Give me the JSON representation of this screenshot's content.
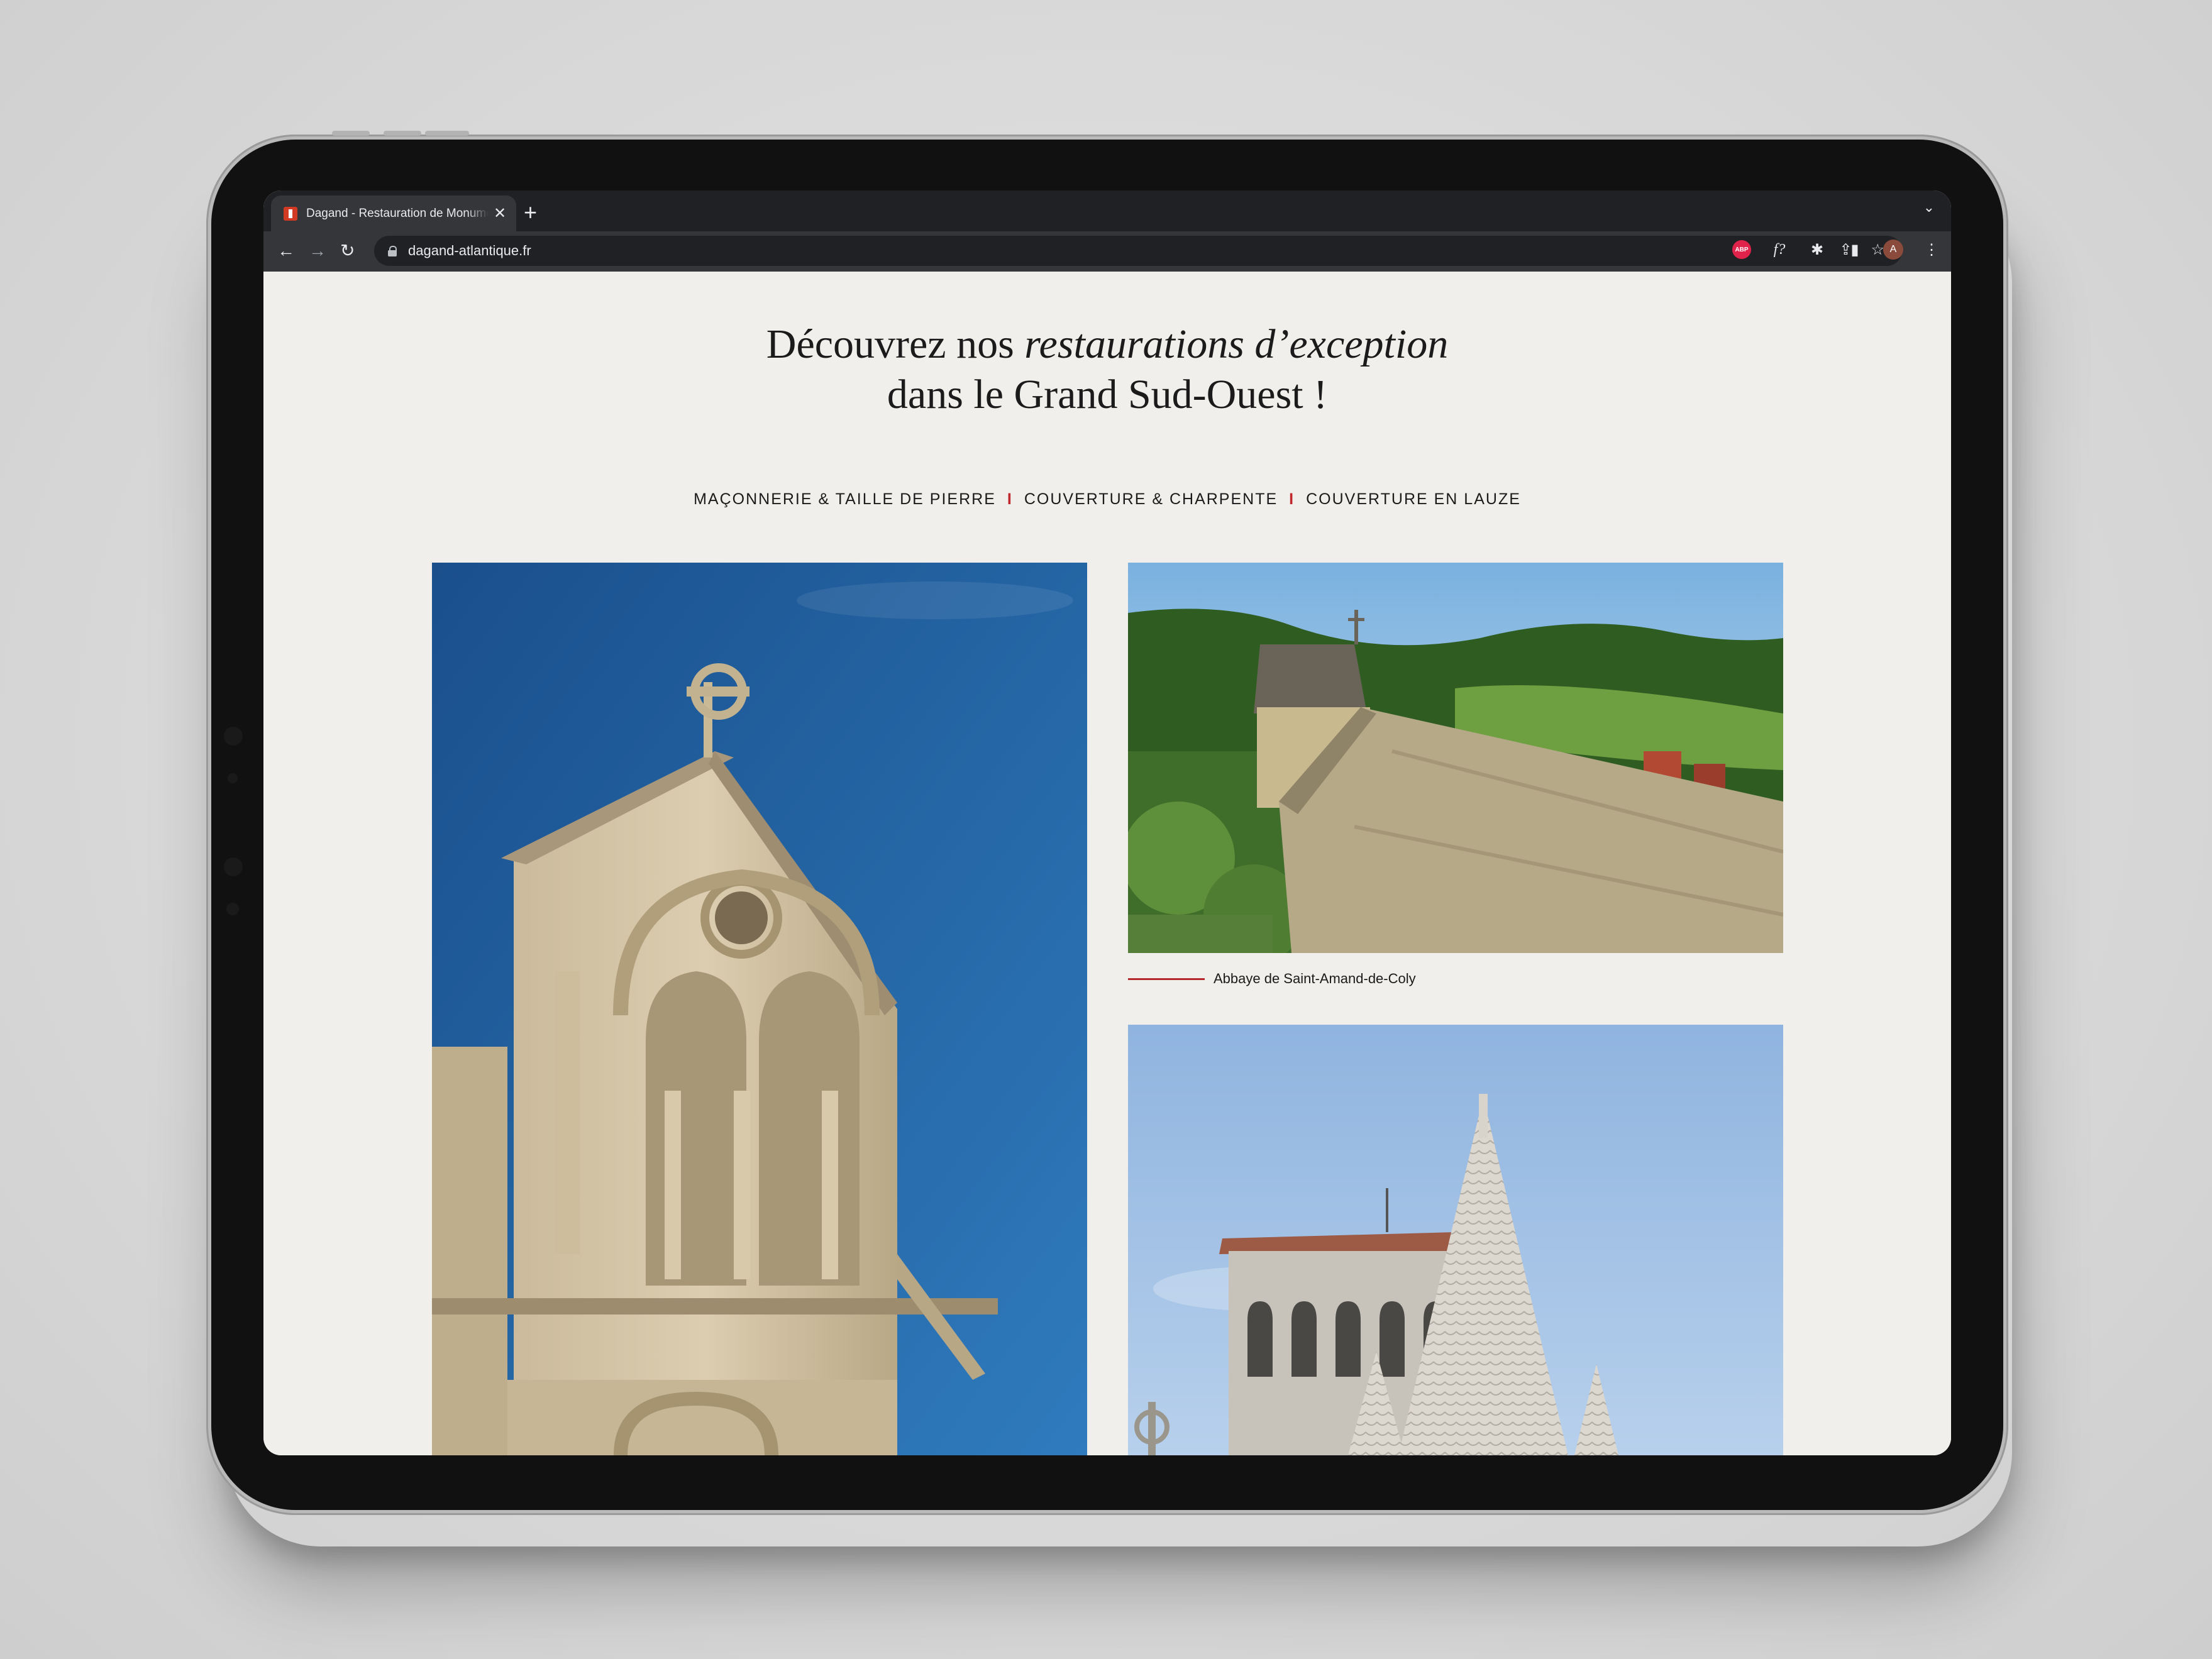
{
  "browser": {
    "tab_title": "Dagand - Restauration de Monuments",
    "tab_close": "✕",
    "new_tab": "+",
    "tab_menu": "⌄",
    "url": "dagand-atlantique.fr",
    "back": "←",
    "forward": "→",
    "reload": "↻",
    "share_icon": "⇪",
    "bookmark_icon": "☆",
    "extensions": {
      "abp_label": "ABP",
      "font_ext": "f?",
      "puzzle": "✱",
      "sidepanel": "▮",
      "avatar_letter": "A",
      "menu": "⋮"
    }
  },
  "page": {
    "heading_line1_plain": "Découvrez nos ",
    "heading_line1_italic": "restaurations d’exception",
    "heading_line2": "dans le Grand Sud-Ouest !",
    "categories": [
      "MAÇONNERIE & TAILLE DE PIERRE",
      "COUVERTURE & CHARPENTE",
      "COUVERTURE EN LAUZE"
    ],
    "category_separator": "I",
    "caption_abbaye": "Abbaye de Saint-Amand-de-Coly",
    "accent_color": "#c0272d"
  }
}
